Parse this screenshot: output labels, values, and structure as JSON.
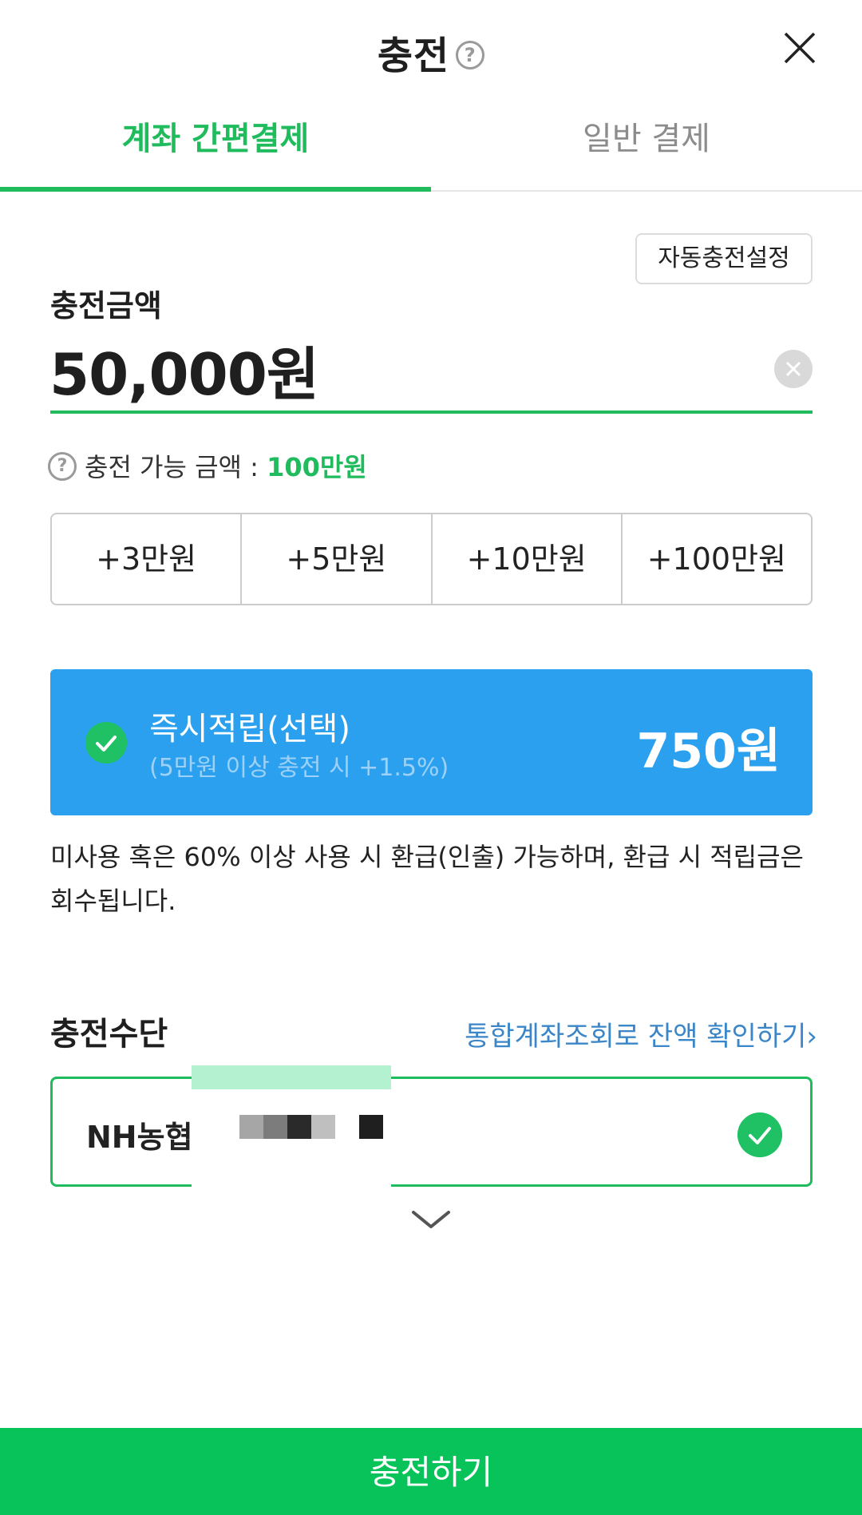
{
  "header": {
    "title": "충전",
    "help_icon": "?"
  },
  "tabs": [
    {
      "label": "계좌 간편결제",
      "active": true
    },
    {
      "label": "일반 결제",
      "active": false
    }
  ],
  "auto_charge_button": "자동충전설정",
  "amount": {
    "label": "충전금액",
    "value": "50,000원"
  },
  "limit": {
    "prefix": "충전 가능 금액 : ",
    "value": "100만원",
    "help_icon": "?"
  },
  "quick_amounts": [
    "+3만원",
    "+5만원",
    "+10만원",
    "+100만원"
  ],
  "reward": {
    "title": "즉시적립(선택)",
    "subtitle": "(5만원 이상 충전 시 +1.5%)",
    "amount": "750원",
    "checked": true
  },
  "notice": "미사용 혹은 60% 이상 사용 시 환급(인출) 가능하며, 환급 시 적립금은 회수됩니다.",
  "payment_method": {
    "label": "충전수단",
    "link": "통합계좌조회로 잔액 확인하기",
    "link_arrow": "›",
    "bank": "NH농협",
    "selected": true
  },
  "charge_button": "충전하기",
  "colors": {
    "accent_green": "#1fbb5d",
    "button_green": "#08c35a",
    "reward_blue": "#2aa0ef",
    "link_blue": "#3a86c8"
  }
}
